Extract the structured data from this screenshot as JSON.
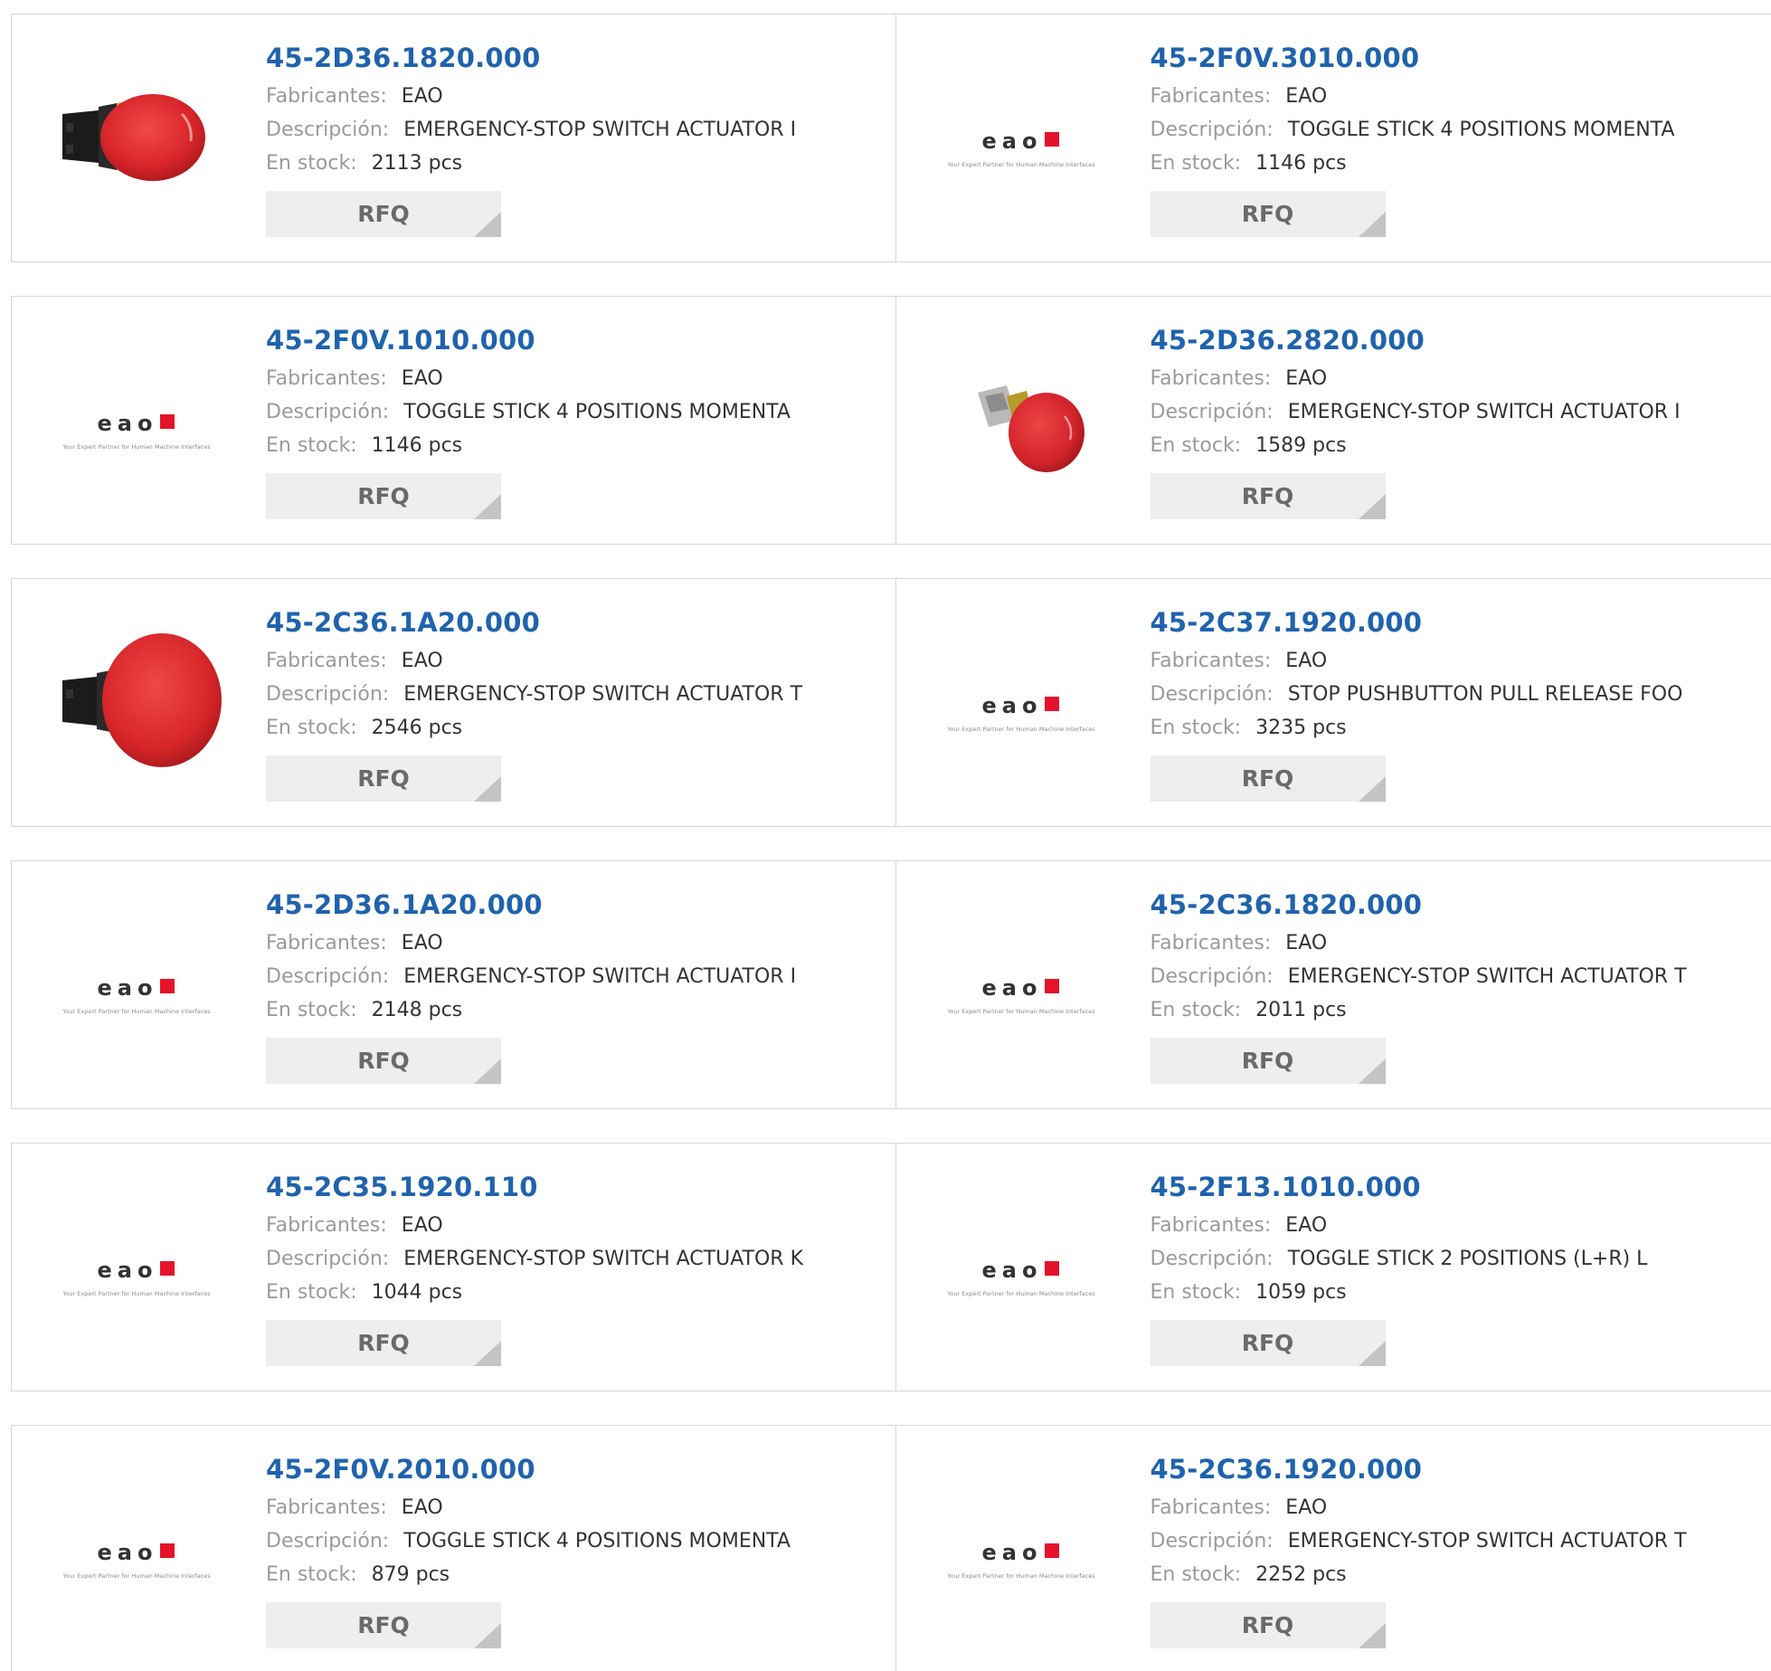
{
  "labels": {
    "manufacturer": "Fabricantes:",
    "description": "Descripción:",
    "stock": "En stock:",
    "rfq": "RFQ"
  },
  "logo": {
    "brand_text": "eao",
    "tagline": "Your Expert Partner for Human Machine Interfaces",
    "brand_square_color": "#e4132a"
  },
  "colors": {
    "part_link": "#1f63ad",
    "label_gray": "#9a9a9a",
    "button_bg": "#eeeeee"
  },
  "products": [
    {
      "part": "45-2D36.1820.000",
      "manufacturer": "EAO",
      "description": "EMERGENCY-STOP SWITCH ACTUATOR I",
      "stock": "2113 pcs",
      "image": "red-emergency-stop-button-photo"
    },
    {
      "part": "45-2F0V.3010.000",
      "manufacturer": "EAO",
      "description": "TOGGLE STICK 4 POSITIONS MOMENTA",
      "stock": "1146 pcs",
      "image": "eao-logo"
    },
    {
      "part": "45-2F0V.1010.000",
      "manufacturer": "EAO",
      "description": "TOGGLE STICK 4 POSITIONS MOMENTA",
      "stock": "1146 pcs",
      "image": "eao-logo"
    },
    {
      "part": "45-2D36.2820.000",
      "manufacturer": "EAO",
      "description": "EMERGENCY-STOP SWITCH ACTUATOR I",
      "stock": "1589 pcs",
      "image": "red-emergency-stop-button-photo-angled"
    },
    {
      "part": "45-2C36.1A20.000",
      "manufacturer": "EAO",
      "description": "EMERGENCY-STOP SWITCH ACTUATOR T",
      "stock": "2546 pcs",
      "image": "red-mushroom-stop-button-photo"
    },
    {
      "part": "45-2C37.1920.000",
      "manufacturer": "EAO",
      "description": "STOP PUSHBUTTON PULL RELEASE FOO",
      "stock": "3235 pcs",
      "image": "eao-logo"
    },
    {
      "part": "45-2D36.1A20.000",
      "manufacturer": "EAO",
      "description": "EMERGENCY-STOP SWITCH ACTUATOR I",
      "stock": "2148 pcs",
      "image": "eao-logo"
    },
    {
      "part": "45-2C36.1820.000",
      "manufacturer": "EAO",
      "description": "EMERGENCY-STOP SWITCH ACTUATOR T",
      "stock": "2011 pcs",
      "image": "eao-logo"
    },
    {
      "part": "45-2C35.1920.110",
      "manufacturer": "EAO",
      "description": "EMERGENCY-STOP SWITCH ACTUATOR K",
      "stock": "1044 pcs",
      "image": "eao-logo"
    },
    {
      "part": "45-2F13.1010.000",
      "manufacturer": "EAO",
      "description": "TOGGLE STICK 2 POSITIONS (L+R) L",
      "stock": "1059 pcs",
      "image": "eao-logo"
    },
    {
      "part": "45-2F0V.2010.000",
      "manufacturer": "EAO",
      "description": "TOGGLE STICK 4 POSITIONS MOMENTA",
      "stock": "879 pcs",
      "image": "eao-logo"
    },
    {
      "part": "45-2C36.1920.000",
      "manufacturer": "EAO",
      "description": "EMERGENCY-STOP SWITCH ACTUATOR T",
      "stock": "2252 pcs",
      "image": "eao-logo"
    }
  ]
}
